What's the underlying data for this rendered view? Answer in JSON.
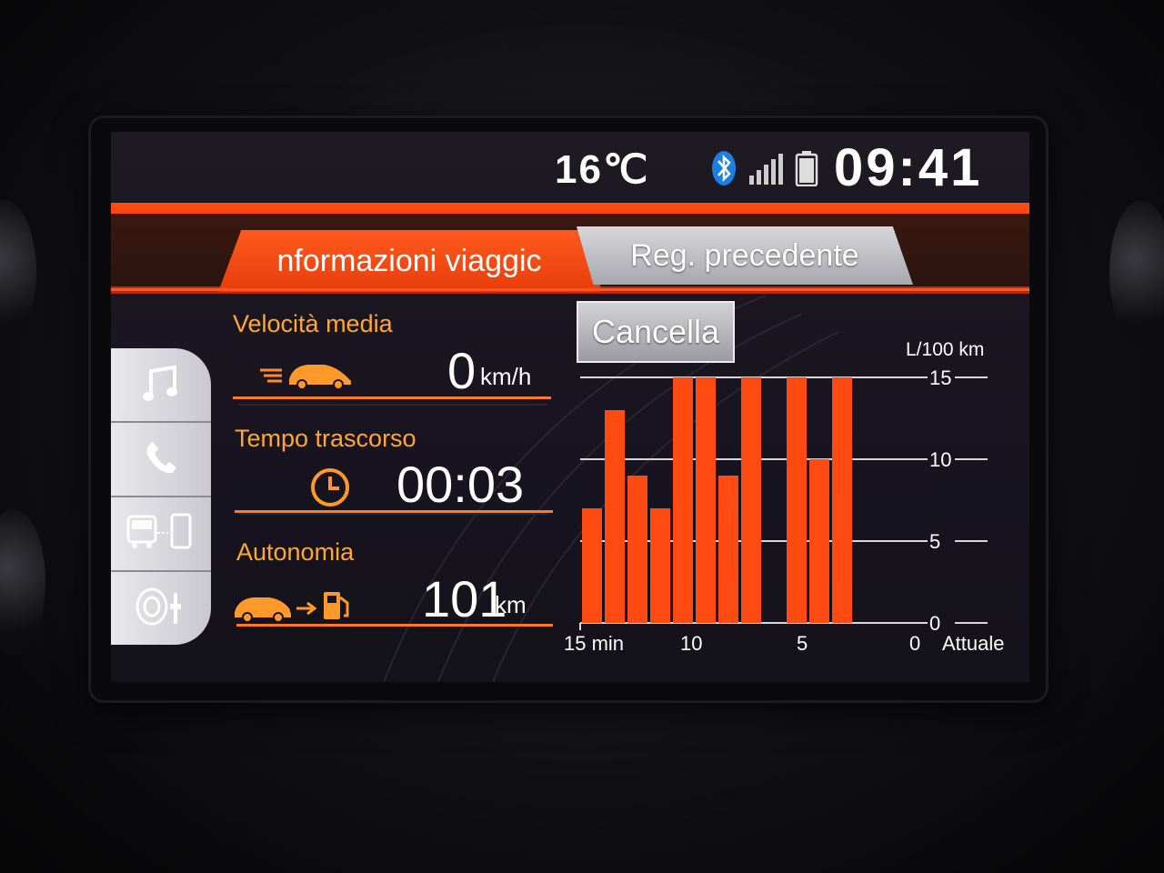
{
  "status": {
    "temperature": "16℃",
    "time": "09:41",
    "icons": [
      "bluetooth-icon",
      "signal-icon",
      "battery-icon"
    ]
  },
  "tabs": {
    "active": "nformazioni viaggic",
    "inactive": "Reg. precedente"
  },
  "sidebar": {
    "items": [
      "music-icon",
      "phone-icon",
      "phone-connect-icon",
      "sound-settings-icon"
    ]
  },
  "info": {
    "speed": {
      "label": "Velocità media",
      "value": "0",
      "unit": "km/h"
    },
    "time": {
      "label": "Tempo trascorso",
      "value": "00:03"
    },
    "range": {
      "label": "Autonomia",
      "value": "101",
      "unit": "km"
    }
  },
  "cancel_label": "Cancella",
  "colors": {
    "accent": "#ff4a12",
    "label": "#ffa72e",
    "bar": "#ff4a12"
  },
  "chart_data": {
    "type": "bar",
    "unit_label": "L/100 km",
    "y_ticks": [
      "15",
      "10",
      "5",
      "0"
    ],
    "x_labels": [
      "15 min",
      "10",
      "5",
      "0",
      "Attuale"
    ],
    "ylim": [
      0,
      15
    ],
    "values": [
      7,
      13,
      9,
      7,
      15,
      15,
      9,
      15,
      0,
      15,
      10,
      15
    ],
    "grid": true
  }
}
